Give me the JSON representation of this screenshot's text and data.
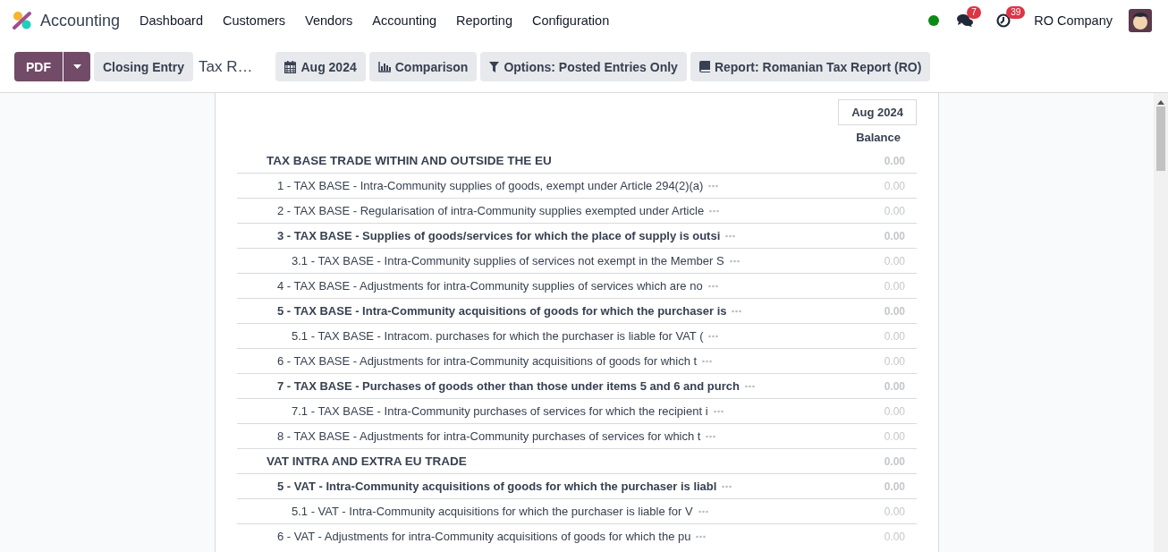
{
  "navbar": {
    "app_name": "Accounting",
    "menu": [
      "Dashboard",
      "Customers",
      "Vendors",
      "Accounting",
      "Reporting",
      "Configuration"
    ],
    "presence_online": true,
    "messages_count": "7",
    "activities_count": "39",
    "company": "RO Company"
  },
  "control_panel": {
    "print_button": "PDF",
    "closing_button": "Closing Entry",
    "breadcrumb": "Tax R…",
    "filters": [
      {
        "kind": "calendar",
        "label": "Aug 2024"
      },
      {
        "kind": "chart",
        "label": "Comparison"
      },
      {
        "kind": "filter",
        "label": "Options: Posted Entries Only"
      },
      {
        "kind": "book",
        "label": "Report: Romanian Tax Report (RO)"
      }
    ]
  },
  "report": {
    "period": "Aug 2024",
    "column": "Balance",
    "sections": [
      {
        "name": "TAX BASE TRADE WITHIN AND OUTSIDE THE EU",
        "value": "0.00",
        "children": [
          {
            "name": "1 - TAX BASE - Intra-Community supplies of goods, exempt under Article 294(2)(a)",
            "value": "0.00",
            "bold": false
          },
          {
            "name": "2 - TAX BASE - Regularisation of intra-Community supplies exempted under Article",
            "value": "0.00",
            "bold": false
          },
          {
            "name": "3 - TAX BASE - Supplies of goods/services for which the place of supply is outsi",
            "value": "0.00",
            "bold": true,
            "children": [
              {
                "name": "3.1 - TAX BASE - Intra-Community supplies of services not exempt in the Member S",
                "value": "0.00",
                "bold": false
              }
            ]
          },
          {
            "name": "4 - TAX BASE - Adjustments for intra-Community supplies of services which are no",
            "value": "0.00",
            "bold": false
          },
          {
            "name": "5 - TAX BASE - Intra-Community acquisitions of goods for which the purchaser is",
            "value": "0.00",
            "bold": true,
            "children": [
              {
                "name": "5.1 - TAX BASE - Intracom. purchases for which the purchaser is liable for VAT (",
                "value": "0.00",
                "bold": false
              }
            ]
          },
          {
            "name": "6 - TAX BASE - Adjustments for intra-Community acquisitions of goods for which t",
            "value": "0.00",
            "bold": false
          },
          {
            "name": "7 - TAX BASE - Purchases of goods other than those under items 5 and 6 and purch",
            "value": "0.00",
            "bold": true,
            "children": [
              {
                "name": "7.1 - TAX BASE - Intra-Community purchases of services for which the recipient i",
                "value": "0.00",
                "bold": false
              }
            ]
          },
          {
            "name": "8 - TAX BASE - Adjustments for intra-Community purchases of services for which t",
            "value": "0.00",
            "bold": false
          }
        ]
      },
      {
        "name": "VAT INTRA AND EXTRA EU TRADE",
        "value": "0.00",
        "children": [
          {
            "name": "5 - VAT - Intra-Community acquisitions of goods for which the purchaser is liabl",
            "value": "0.00",
            "bold": true,
            "children": [
              {
                "name": "5.1 - VAT - Intra-Community acquisitions for which the purchaser is liable for V",
                "value": "0.00",
                "bold": false
              }
            ]
          },
          {
            "name": "6 - VAT - Adjustments for intra-Community acquisitions of goods for which the pu",
            "value": "0.00",
            "bold": false
          }
        ]
      }
    ]
  }
}
